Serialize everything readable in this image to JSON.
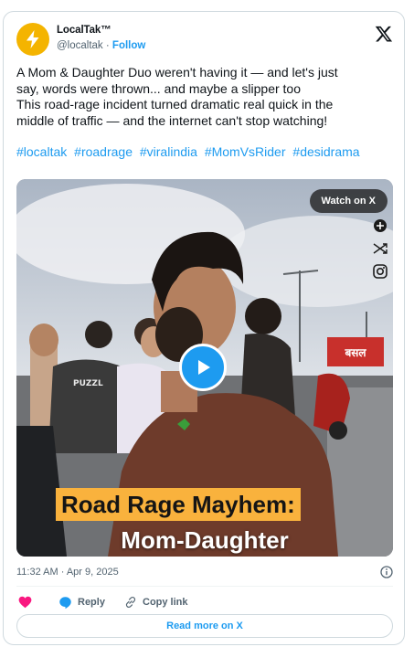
{
  "author": {
    "display_name": "LocalTak™",
    "handle": "@localtak",
    "separator": "·",
    "follow_label": "Follow"
  },
  "tweet": {
    "lines": [
      "A Mom & Daughter Duo weren't having it — and let's just",
      "say, words were thrown... and maybe a slipper too",
      "This road-rage incident turned dramatic real quick in the",
      "middle of traffic — and the internet can't stop watching!"
    ],
    "hashtags": [
      "#localtak",
      "#roadrage",
      "#viralindia",
      "#MomVsRider",
      "#desidrama"
    ]
  },
  "media": {
    "watch_label": "Watch on X",
    "shirt_text": "PUZZL",
    "shop_sign": "बसल",
    "caption_line1": "Road Rage Mayhem:",
    "caption_line2": "Mom-Daughter",
    "icons": [
      "crosshair-icon",
      "shuffle-icon",
      "instagram-icon",
      "play-icon"
    ]
  },
  "meta": {
    "timestamp": "11:32 AM · Apr 9, 2025"
  },
  "actions": {
    "reply_label": "Reply",
    "copy_link_label": "Copy link"
  },
  "footer": {
    "read_more_label": "Read more on X"
  },
  "colors": {
    "accent": "#1d9bf0",
    "like": "#f91880",
    "caption_bg": "#f9b23d",
    "avatar_bg": "#f4b400"
  }
}
